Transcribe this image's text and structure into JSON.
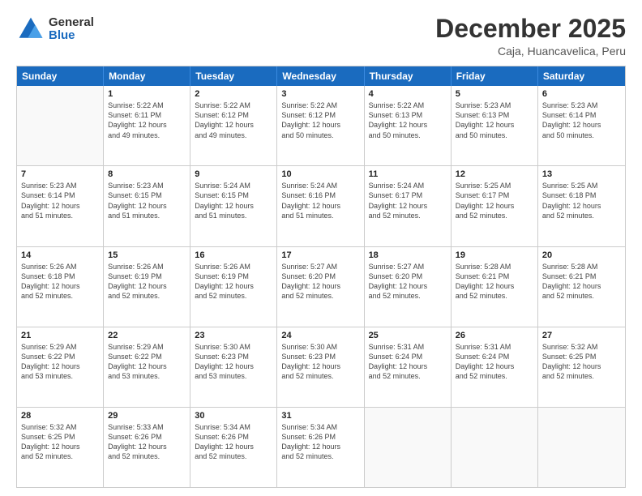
{
  "logo": {
    "general": "General",
    "blue": "Blue"
  },
  "title": "December 2025",
  "location": "Caja, Huancavelica, Peru",
  "days_of_week": [
    "Sunday",
    "Monday",
    "Tuesday",
    "Wednesday",
    "Thursday",
    "Friday",
    "Saturday"
  ],
  "weeks": [
    [
      {
        "day": "",
        "info": ""
      },
      {
        "day": "1",
        "info": "Sunrise: 5:22 AM\nSunset: 6:11 PM\nDaylight: 12 hours\nand 49 minutes."
      },
      {
        "day": "2",
        "info": "Sunrise: 5:22 AM\nSunset: 6:12 PM\nDaylight: 12 hours\nand 49 minutes."
      },
      {
        "day": "3",
        "info": "Sunrise: 5:22 AM\nSunset: 6:12 PM\nDaylight: 12 hours\nand 50 minutes."
      },
      {
        "day": "4",
        "info": "Sunrise: 5:22 AM\nSunset: 6:13 PM\nDaylight: 12 hours\nand 50 minutes."
      },
      {
        "day": "5",
        "info": "Sunrise: 5:23 AM\nSunset: 6:13 PM\nDaylight: 12 hours\nand 50 minutes."
      },
      {
        "day": "6",
        "info": "Sunrise: 5:23 AM\nSunset: 6:14 PM\nDaylight: 12 hours\nand 50 minutes."
      }
    ],
    [
      {
        "day": "7",
        "info": "Sunrise: 5:23 AM\nSunset: 6:14 PM\nDaylight: 12 hours\nand 51 minutes."
      },
      {
        "day": "8",
        "info": "Sunrise: 5:23 AM\nSunset: 6:15 PM\nDaylight: 12 hours\nand 51 minutes."
      },
      {
        "day": "9",
        "info": "Sunrise: 5:24 AM\nSunset: 6:15 PM\nDaylight: 12 hours\nand 51 minutes."
      },
      {
        "day": "10",
        "info": "Sunrise: 5:24 AM\nSunset: 6:16 PM\nDaylight: 12 hours\nand 51 minutes."
      },
      {
        "day": "11",
        "info": "Sunrise: 5:24 AM\nSunset: 6:17 PM\nDaylight: 12 hours\nand 52 minutes."
      },
      {
        "day": "12",
        "info": "Sunrise: 5:25 AM\nSunset: 6:17 PM\nDaylight: 12 hours\nand 52 minutes."
      },
      {
        "day": "13",
        "info": "Sunrise: 5:25 AM\nSunset: 6:18 PM\nDaylight: 12 hours\nand 52 minutes."
      }
    ],
    [
      {
        "day": "14",
        "info": "Sunrise: 5:26 AM\nSunset: 6:18 PM\nDaylight: 12 hours\nand 52 minutes."
      },
      {
        "day": "15",
        "info": "Sunrise: 5:26 AM\nSunset: 6:19 PM\nDaylight: 12 hours\nand 52 minutes."
      },
      {
        "day": "16",
        "info": "Sunrise: 5:26 AM\nSunset: 6:19 PM\nDaylight: 12 hours\nand 52 minutes."
      },
      {
        "day": "17",
        "info": "Sunrise: 5:27 AM\nSunset: 6:20 PM\nDaylight: 12 hours\nand 52 minutes."
      },
      {
        "day": "18",
        "info": "Sunrise: 5:27 AM\nSunset: 6:20 PM\nDaylight: 12 hours\nand 52 minutes."
      },
      {
        "day": "19",
        "info": "Sunrise: 5:28 AM\nSunset: 6:21 PM\nDaylight: 12 hours\nand 52 minutes."
      },
      {
        "day": "20",
        "info": "Sunrise: 5:28 AM\nSunset: 6:21 PM\nDaylight: 12 hours\nand 52 minutes."
      }
    ],
    [
      {
        "day": "21",
        "info": "Sunrise: 5:29 AM\nSunset: 6:22 PM\nDaylight: 12 hours\nand 53 minutes."
      },
      {
        "day": "22",
        "info": "Sunrise: 5:29 AM\nSunset: 6:22 PM\nDaylight: 12 hours\nand 53 minutes."
      },
      {
        "day": "23",
        "info": "Sunrise: 5:30 AM\nSunset: 6:23 PM\nDaylight: 12 hours\nand 53 minutes."
      },
      {
        "day": "24",
        "info": "Sunrise: 5:30 AM\nSunset: 6:23 PM\nDaylight: 12 hours\nand 52 minutes."
      },
      {
        "day": "25",
        "info": "Sunrise: 5:31 AM\nSunset: 6:24 PM\nDaylight: 12 hours\nand 52 minutes."
      },
      {
        "day": "26",
        "info": "Sunrise: 5:31 AM\nSunset: 6:24 PM\nDaylight: 12 hours\nand 52 minutes."
      },
      {
        "day": "27",
        "info": "Sunrise: 5:32 AM\nSunset: 6:25 PM\nDaylight: 12 hours\nand 52 minutes."
      }
    ],
    [
      {
        "day": "28",
        "info": "Sunrise: 5:32 AM\nSunset: 6:25 PM\nDaylight: 12 hours\nand 52 minutes."
      },
      {
        "day": "29",
        "info": "Sunrise: 5:33 AM\nSunset: 6:26 PM\nDaylight: 12 hours\nand 52 minutes."
      },
      {
        "day": "30",
        "info": "Sunrise: 5:34 AM\nSunset: 6:26 PM\nDaylight: 12 hours\nand 52 minutes."
      },
      {
        "day": "31",
        "info": "Sunrise: 5:34 AM\nSunset: 6:26 PM\nDaylight: 12 hours\nand 52 minutes."
      },
      {
        "day": "",
        "info": ""
      },
      {
        "day": "",
        "info": ""
      },
      {
        "day": "",
        "info": ""
      }
    ]
  ]
}
